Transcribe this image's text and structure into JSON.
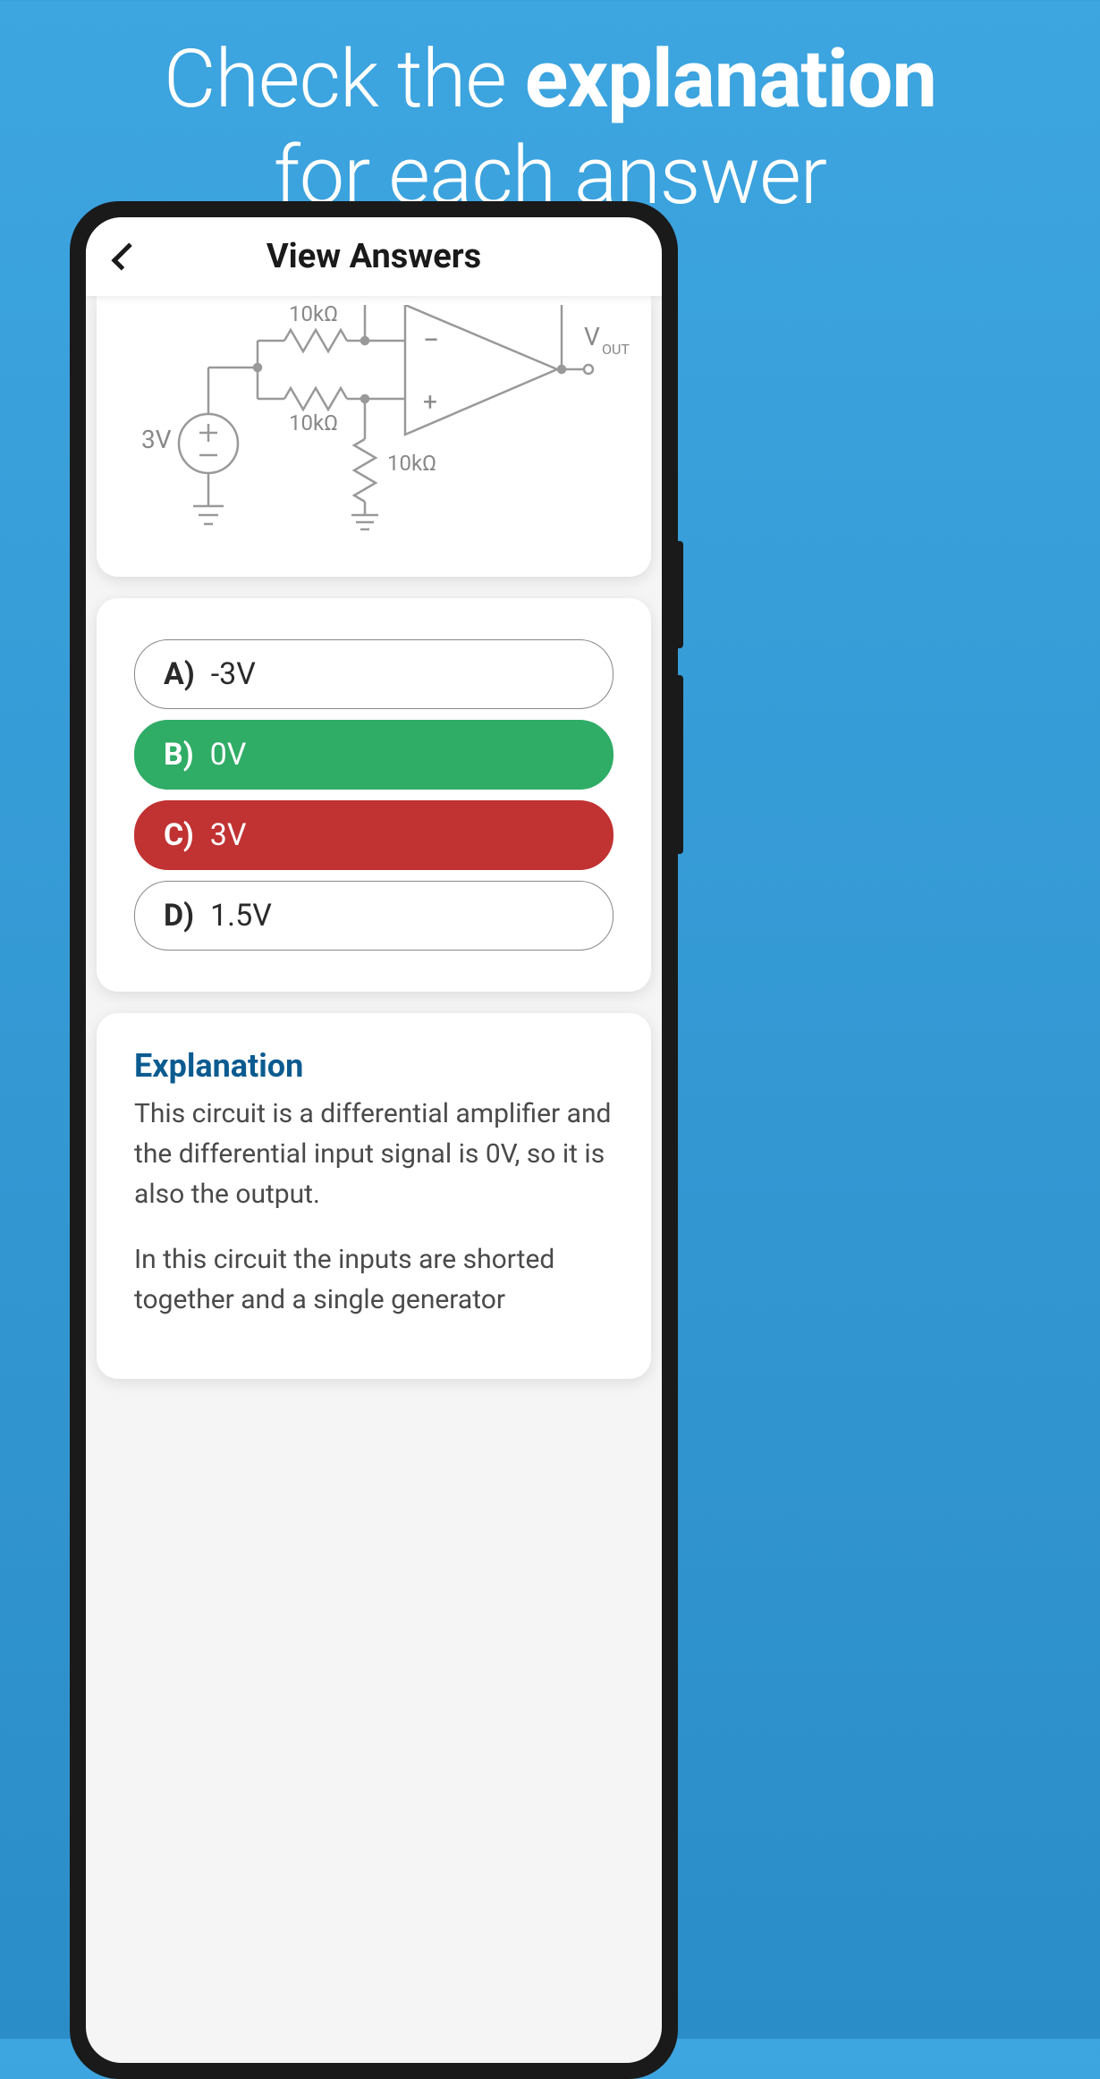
{
  "promo": {
    "line1_pre": "Check the ",
    "line1_bold": "explanation",
    "line2": "for each answer"
  },
  "header": {
    "title": "View Answers"
  },
  "circuit": {
    "source_label": "3V",
    "r1_label": "10kΩ",
    "r2_label": "10kΩ",
    "r3_label": "10kΩ",
    "vout_v": "V",
    "vout_sub": "OUT"
  },
  "answers": [
    {
      "letter": "A)",
      "text": "-3V",
      "status": "neutral"
    },
    {
      "letter": "B)",
      "text": "0V",
      "status": "correct"
    },
    {
      "letter": "C)",
      "text": "3V",
      "status": "incorrect"
    },
    {
      "letter": "D)",
      "text": "1.5V",
      "status": "neutral"
    }
  ],
  "explanation": {
    "title": "Explanation",
    "para1": "This circuit is a differential amplifier and the differential input signal is 0V, so it is also the output.",
    "para2": "In this circuit the inputs are shorted together and a single generator"
  }
}
